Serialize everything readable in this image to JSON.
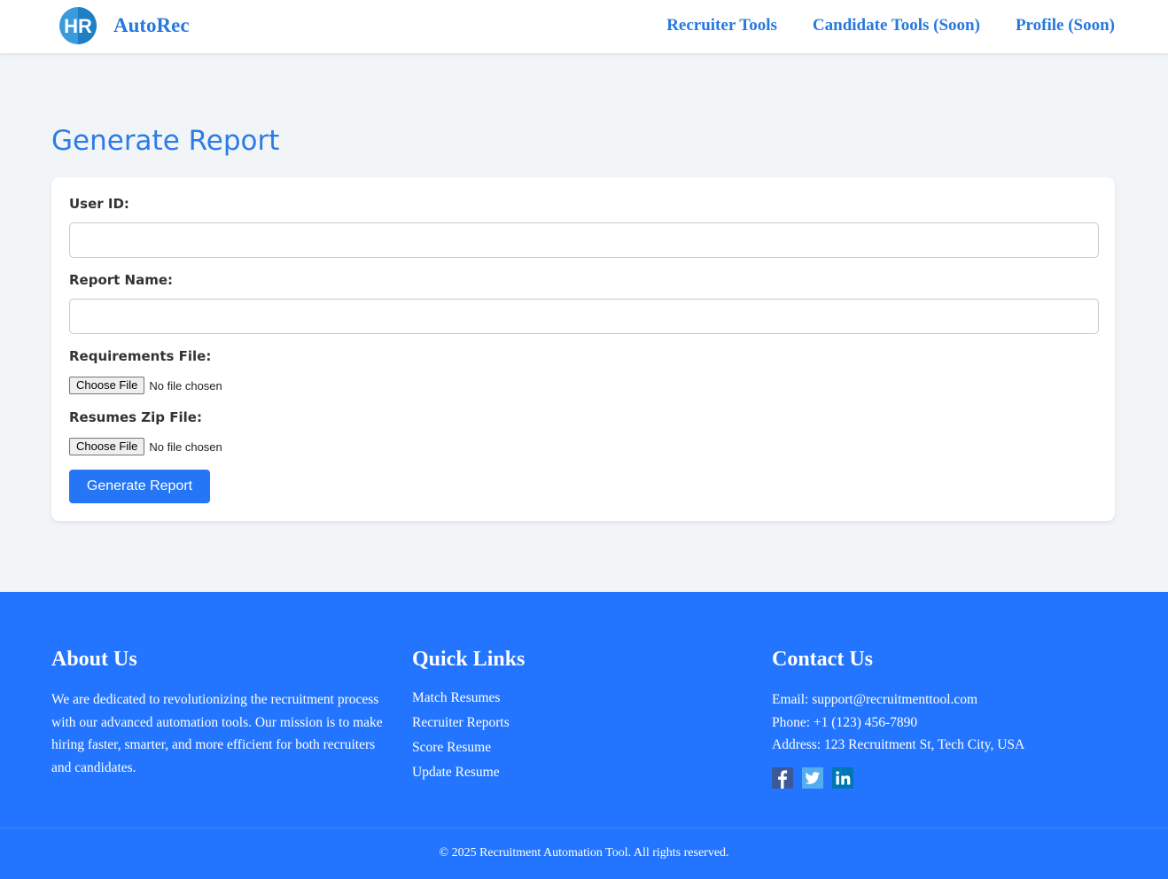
{
  "header": {
    "logo_icon": "hr-logo-icon",
    "brand": "AutoRec",
    "nav": [
      {
        "label": "Recruiter Tools"
      },
      {
        "label": "Candidate Tools (Soon)"
      },
      {
        "label": "Profile (Soon)"
      }
    ]
  },
  "main": {
    "title": "Generate Report",
    "form": {
      "user_id_label": "User ID:",
      "user_id_value": "",
      "report_name_label": "Report Name:",
      "report_name_value": "",
      "requirements_label": "Requirements File:",
      "requirements_button": "Choose File",
      "requirements_status": "No file chosen",
      "resumes_label": "Resumes Zip File:",
      "resumes_button": "Choose File",
      "resumes_status": "No file chosen",
      "submit_label": "Generate Report"
    }
  },
  "footer": {
    "about": {
      "heading": "About Us",
      "text": "We are dedicated to revolutionizing the recruitment process with our advanced automation tools. Our mission is to make hiring faster, smarter, and more efficient for both recruiters and candidates."
    },
    "quick_links": {
      "heading": "Quick Links",
      "links": [
        "Match Resumes",
        "Recruiter Reports",
        "Score Resume",
        "Update Resume"
      ]
    },
    "contact": {
      "heading": "Contact Us",
      "email": "Email: support@recruitmenttool.com",
      "phone": "Phone: +1 (123) 456-7890",
      "address": "Address: 123 Recruitment St, Tech City, USA"
    },
    "socials": [
      "facebook-icon",
      "twitter-icon",
      "linkedin-icon"
    ],
    "copyright": "© 2025 Recruitment Automation Tool. All rights reserved."
  },
  "colors": {
    "accent": "#2779df",
    "button": "#2576f7",
    "footer_bg": "#2375ff",
    "page_bg": "#f2f5f8"
  }
}
